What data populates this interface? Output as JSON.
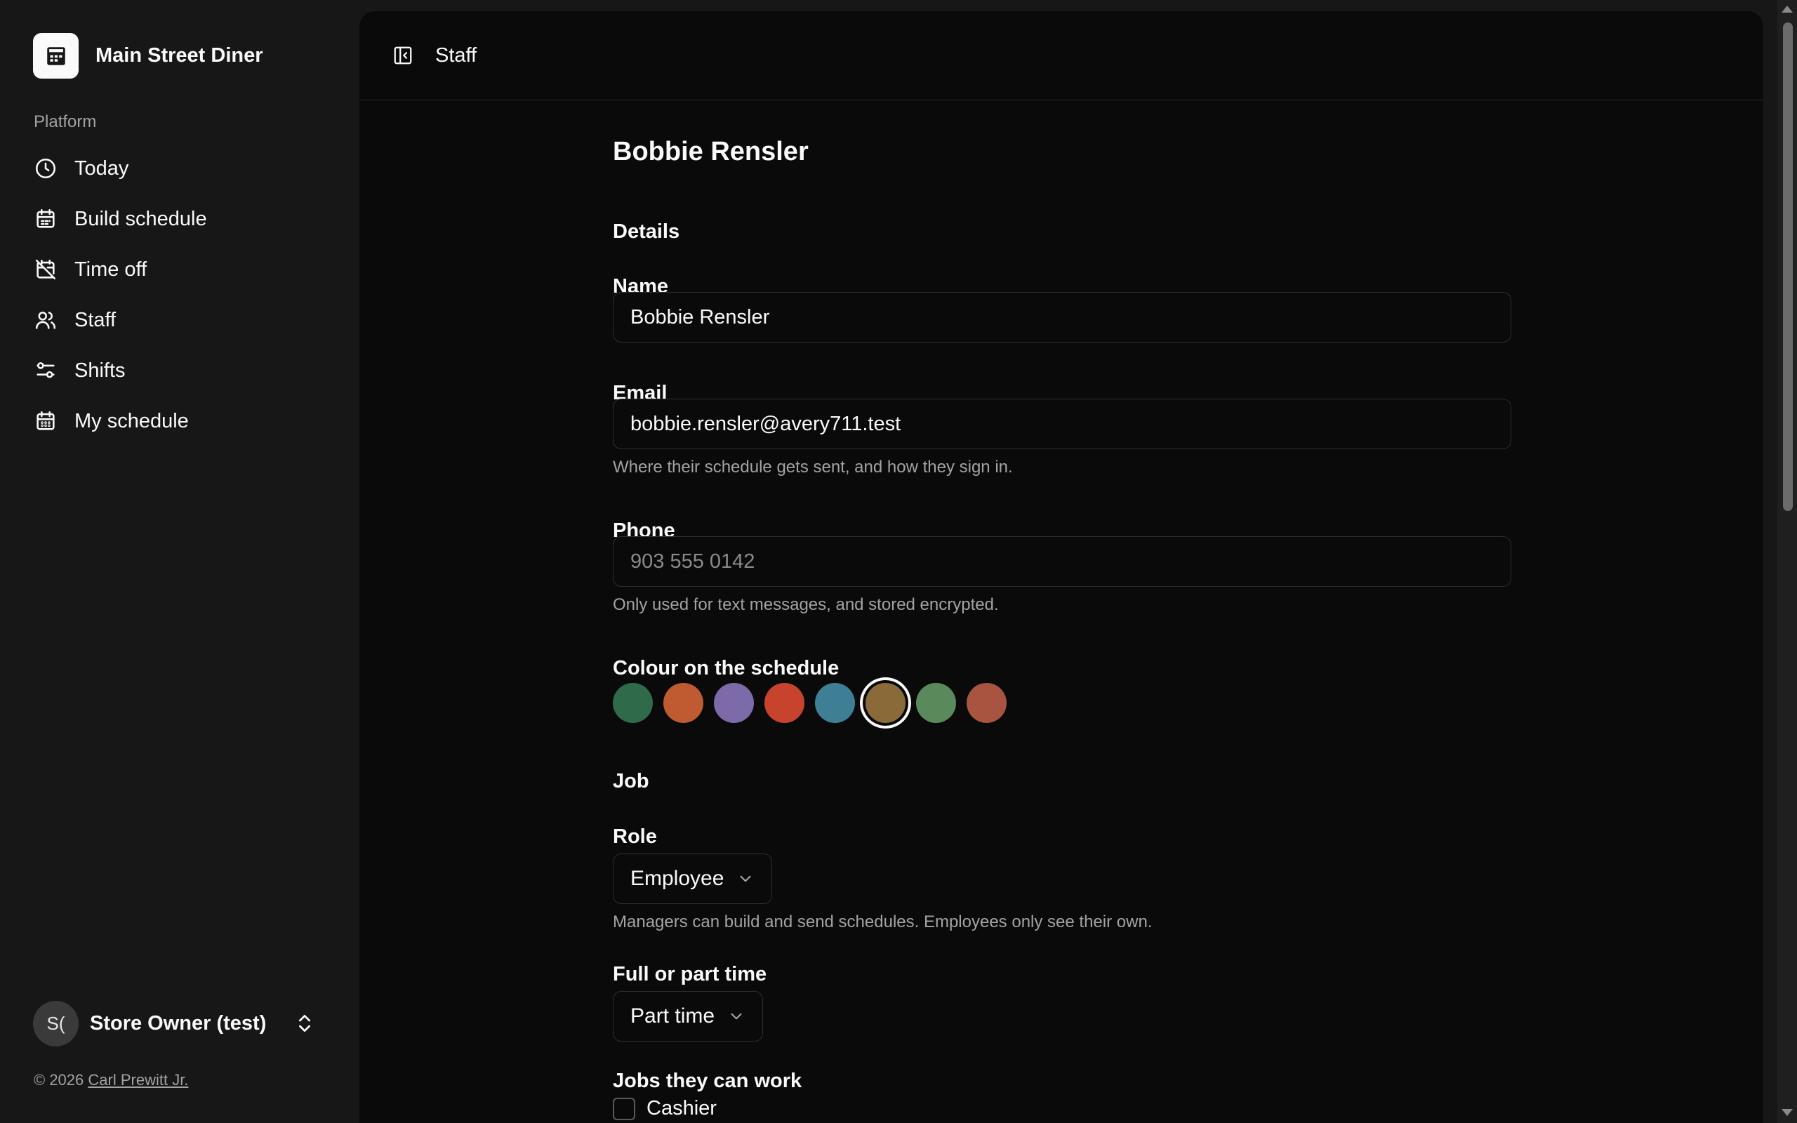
{
  "brand": {
    "name": "Main Street Diner"
  },
  "sidebar": {
    "section_label": "Platform",
    "items": [
      {
        "label": "Today",
        "icon": "clock-icon"
      },
      {
        "label": "Build schedule",
        "icon": "calendar-grid-icon"
      },
      {
        "label": "Time off",
        "icon": "calendar-off-icon"
      },
      {
        "label": "Staff",
        "icon": "users-icon"
      },
      {
        "label": "Shifts",
        "icon": "sliders-icon"
      },
      {
        "label": "My schedule",
        "icon": "calendar-dots-icon"
      }
    ],
    "user": {
      "initials": "S(",
      "name": "Store Owner (test)"
    },
    "copyright_prefix": "© 2026",
    "copyright_link": "Carl Prewitt Jr."
  },
  "header": {
    "title": "Staff"
  },
  "form": {
    "page_title": "Bobbie Rensler",
    "details_heading": "Details",
    "name_label": "Name",
    "name_value": "Bobbie Rensler",
    "email_label": "Email",
    "email_value": "bobbie.rensler@avery711.test",
    "email_help": "Where their schedule gets sent, and how they sign in.",
    "phone_label": "Phone",
    "phone_placeholder": "903 555 0142",
    "phone_help": "Only used for text messages, and stored encrypted.",
    "colour_label": "Colour on the schedule",
    "colours": [
      "#2f6b4a",
      "#c05a30",
      "#7d6aa8",
      "#c8432e",
      "#3f7f96",
      "#8a6a38",
      "#5a8a5c",
      "#a85440"
    ],
    "selected_colour_index": 5,
    "job_heading": "Job",
    "role_label": "Role",
    "role_value": "Employee",
    "role_help": "Managers can build and send schedules. Employees only see their own.",
    "time_label": "Full or part time",
    "time_value": "Part time",
    "jobs_label": "Jobs they can work",
    "jobs": [
      {
        "label": "Cashier",
        "checked": false
      }
    ]
  }
}
